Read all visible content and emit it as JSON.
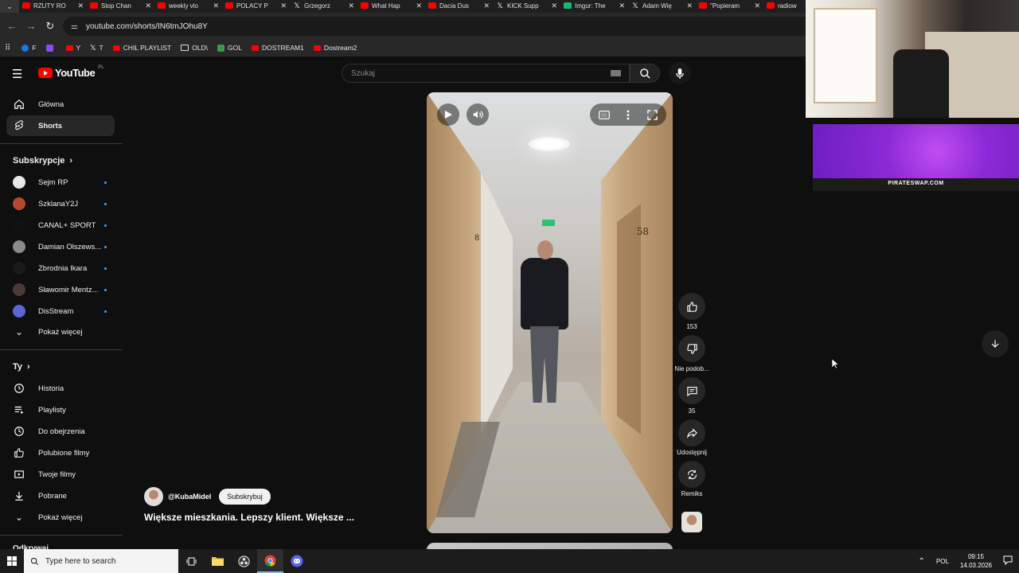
{
  "browser": {
    "tabs": [
      {
        "title": "RZUTY RO",
        "icon": "youtube"
      },
      {
        "title": "Stop Chan",
        "icon": "youtube"
      },
      {
        "title": "weekly vlo",
        "icon": "youtube"
      },
      {
        "title": "POLACY P",
        "icon": "youtube"
      },
      {
        "title": "Grzegorz",
        "icon": "x"
      },
      {
        "title": "What Hap",
        "icon": "youtube"
      },
      {
        "title": "Dacia Dus",
        "icon": "youtube"
      },
      {
        "title": "KICK Supp",
        "icon": "x"
      },
      {
        "title": "Imgur: The",
        "icon": "imgur"
      },
      {
        "title": "Adam Wię",
        "icon": "x"
      },
      {
        "title": "\"Popieram",
        "icon": "youtube"
      },
      {
        "title": "radiow",
        "icon": "youtube"
      }
    ],
    "url": "youtube.com/shorts/IN6tmJOhu8Y",
    "bookmarks": [
      {
        "label": "F",
        "icon": "facebook"
      },
      {
        "label": "",
        "icon": "twitch"
      },
      {
        "label": "Y",
        "icon": "youtube"
      },
      {
        "label": "T",
        "icon": "x"
      },
      {
        "label": "CHIL PLAYLIST",
        "icon": "youtube"
      },
      {
        "label": "OLD\\",
        "icon": "folder"
      },
      {
        "label": "GOL",
        "icon": "gol"
      },
      {
        "label": "DOSTREAM1",
        "icon": "youtube"
      },
      {
        "label": "Dostream2",
        "icon": "youtube"
      }
    ]
  },
  "youtube": {
    "logo_text": "YouTube",
    "region": "PL",
    "search_placeholder": "Szukaj",
    "sidebar": {
      "main": [
        {
          "label": "Główna",
          "icon": "home-icon"
        },
        {
          "label": "Shorts",
          "icon": "shorts-icon",
          "active": true
        }
      ],
      "subscriptions_title": "Subskrypcje",
      "subscriptions": [
        {
          "label": "Sejm RP",
          "color": "#e8e8e8"
        },
        {
          "label": "SzklanaY2J",
          "color": "#b5482f"
        },
        {
          "label": "CANAL+ SPORT",
          "color": "#111111"
        },
        {
          "label": "Damian Olszews...",
          "color": "#8a8a8a"
        },
        {
          "label": "Zbrodnia Ikara",
          "color": "#1a1a1a"
        },
        {
          "label": "Sławomir Mentz...",
          "color": "#4a3a35"
        },
        {
          "label": "DisStream",
          "color": "#5a66d8"
        }
      ],
      "show_more_1": "Pokaż więcej",
      "you_title": "Ty",
      "you_items": [
        {
          "label": "Historia",
          "icon": "history-icon"
        },
        {
          "label": "Playlisty",
          "icon": "playlist-icon"
        },
        {
          "label": "Do obejrzenia",
          "icon": "watch-later-icon"
        },
        {
          "label": "Polubione filmy",
          "icon": "like-icon"
        },
        {
          "label": "Twoje filmy",
          "icon": "your-videos-icon"
        },
        {
          "label": "Pobrane",
          "icon": "download-icon"
        }
      ],
      "show_more_2": "Pokaż więcej",
      "cut_heading": "Odkrywaj"
    },
    "short": {
      "channel": "@KubaMidel",
      "subscribe_label": "Subskrybuj",
      "title": "Większe mieszkania. Lepszy klient. Większe ...",
      "actions": {
        "likes": "153",
        "dislike_label": "Nie podob...",
        "comments": "35",
        "share_label": "Udostępnij",
        "remix_label": "Remiks"
      }
    }
  },
  "overlay": {
    "ad_text": "PIRATESWAP.COM"
  },
  "taskbar": {
    "search_placeholder": "Type here to search",
    "language": "POL",
    "time": "09:15",
    "date": "14.03.2026"
  }
}
